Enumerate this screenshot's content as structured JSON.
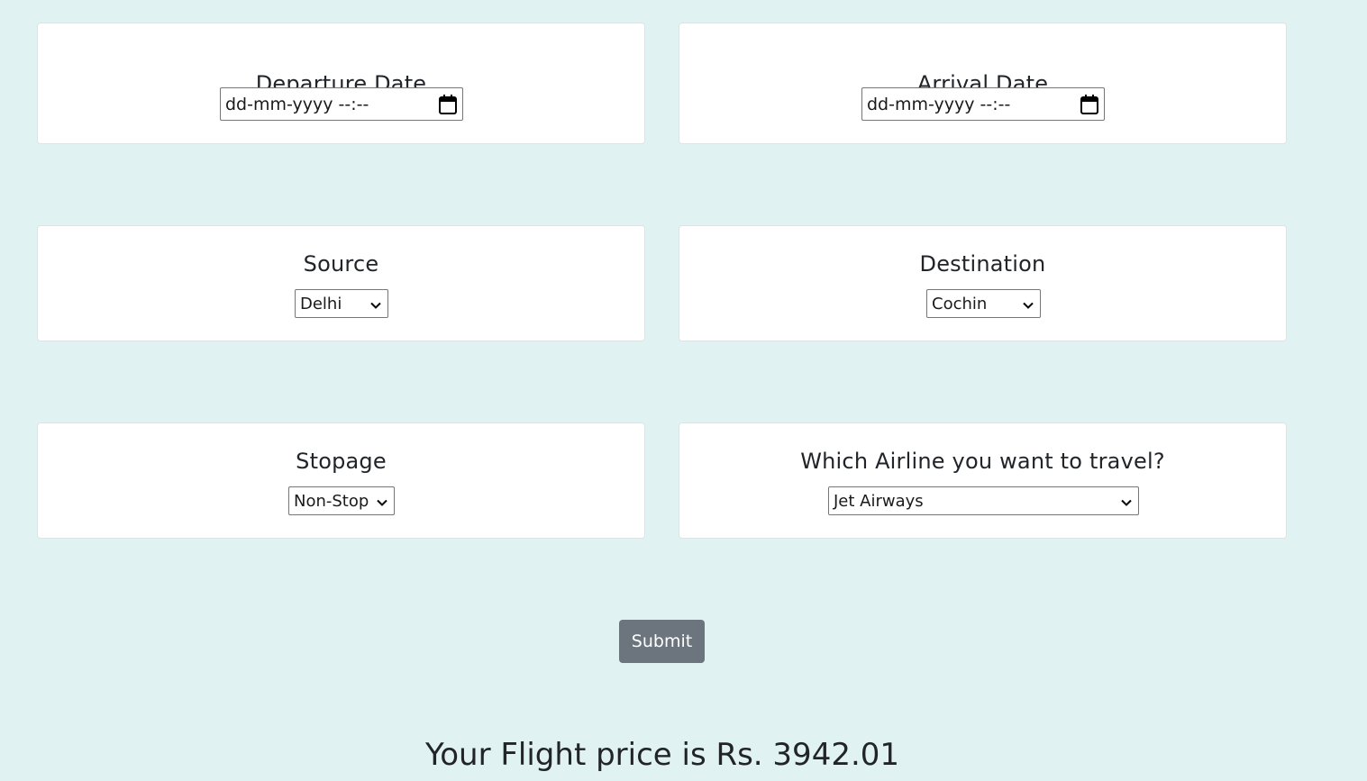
{
  "departure": {
    "title": "Departure Date",
    "placeholder": "dd-mm-yyyy --:--"
  },
  "arrival": {
    "title": "Arrival Date",
    "placeholder": "dd-mm-yyyy --:--"
  },
  "source": {
    "title": "Source",
    "selected": "Delhi"
  },
  "destination": {
    "title": "Destination",
    "selected": "Cochin"
  },
  "stopage": {
    "title": "Stopage",
    "selected": "Non-Stop"
  },
  "airline": {
    "title": "Which Airline you want to travel?",
    "selected": "Jet Airways"
  },
  "form": {
    "submit_label": "Submit"
  },
  "result": {
    "text": "Your Flight price is Rs. 3942.01"
  },
  "icons": {
    "calendar": "calendar-icon",
    "dropdown": "chevron-down-icon"
  },
  "colors": {
    "background": "#e0f2f1",
    "button": "#6c757d"
  }
}
